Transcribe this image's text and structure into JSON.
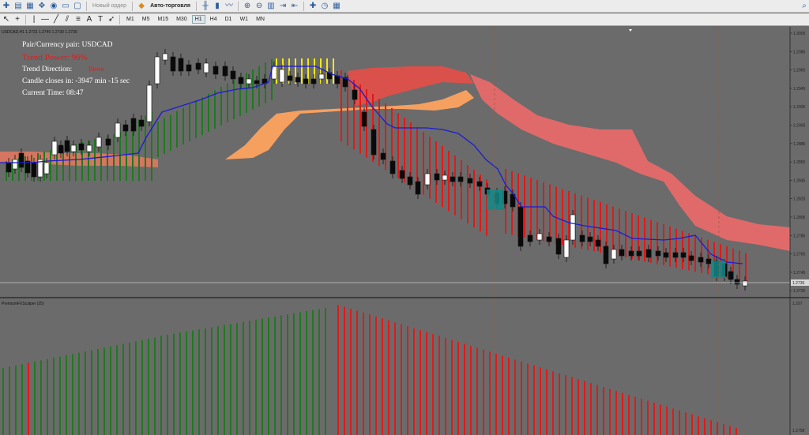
{
  "toolbar": {
    "new_order_label": "Новый ордер",
    "autotrading_label": "Авто-торговля",
    "timeframes": [
      "M1",
      "M5",
      "M15",
      "M30",
      "H1",
      "H4",
      "D1",
      "W1",
      "MN"
    ],
    "active_timeframe": "H1"
  },
  "chart": {
    "header": "USDCAD,H1  1.2731 1.2740 1.2730 1.2736",
    "current_price_label": "1.2736",
    "price_ticks": [
      "1.3005",
      "1.2985",
      "1.2965",
      "1.2945",
      "1.2925",
      "1.2905",
      "1.2885",
      "1.2865",
      "1.2845",
      "1.2825",
      "1.2805",
      "1.2785",
      "1.2765",
      "1.2745",
      "1.2725"
    ],
    "info": {
      "pair": "Pair/Currency pair: USDCAD",
      "trend_power": "Trend Power: 96%",
      "trend_direction_label": "Trend Direction:",
      "trend_direction_value": "Down",
      "candle_closes": "Candle closes in: -3947 min -15 sec",
      "current_time": "Current Time: 08:47"
    }
  },
  "indicator": {
    "title": "PremiumFXScalper (25)",
    "top_value": "1.297",
    "bottom_value": "1.2758"
  },
  "colors": {
    "background": "#6b6b6b",
    "bull_bar": "#1f7a1f",
    "bear_bar": "#e01a1a",
    "kijun": "#1b1bd6",
    "cloud_bull": "#f6a060",
    "cloud_bear": "#e06a6a"
  }
}
